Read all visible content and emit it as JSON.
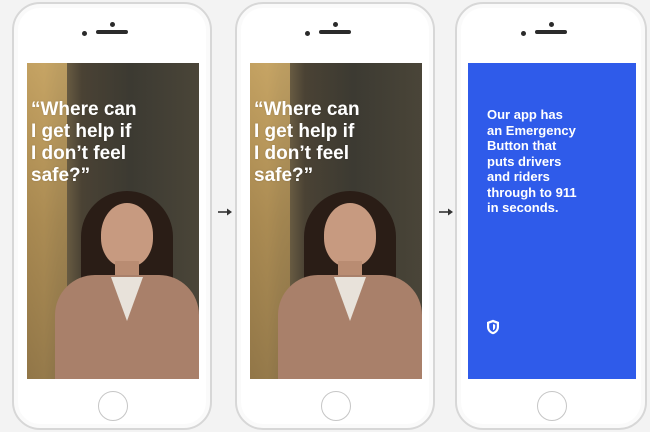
{
  "flow": {
    "screens": [
      {
        "quote": "“Where can\nI get help if\nI don’t feel\nsafe?”"
      },
      {
        "quote": "“Where can\nI get help if\nI don’t feel\nsafe?”"
      },
      {
        "message": "Our app has\nan Emergency\nButton that\nputs drivers\nand riders\nthrough to 911\nin seconds.",
        "icon": "shield-icon"
      }
    ],
    "arrow_icon": "arrow-right-icon"
  },
  "colors": {
    "accent_blue": "#2f5bea",
    "text_white": "#ffffff",
    "phone_frame": "#ffffff"
  }
}
